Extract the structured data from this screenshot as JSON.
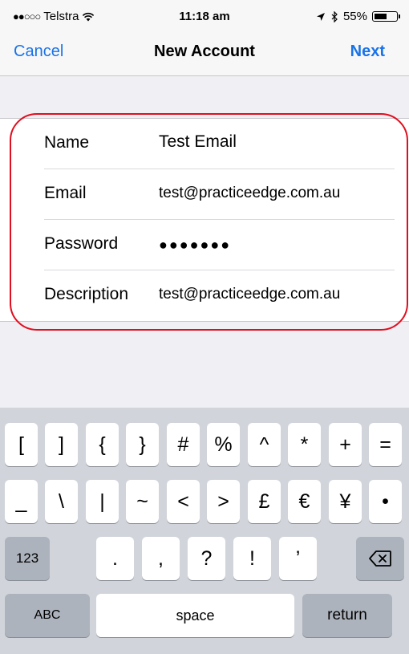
{
  "status": {
    "carrier": "Telstra",
    "time": "11:18 am",
    "battery": "55%",
    "signal_dots": "●●○○○"
  },
  "nav": {
    "cancel": "Cancel",
    "title": "New Account",
    "next": "Next"
  },
  "form": {
    "rows": [
      {
        "label": "Name",
        "value": "Test Email"
      },
      {
        "label": "Email",
        "value": "test@practiceedge.com.au"
      },
      {
        "label": "Password",
        "value": "●●●●●●●"
      },
      {
        "label": "Description",
        "value": "test@practiceedge.com.au"
      }
    ]
  },
  "keyboard": {
    "row1": [
      "[",
      "]",
      "{",
      "}",
      "#",
      "%",
      "^",
      "*",
      "+",
      "="
    ],
    "row2": [
      "_",
      "\\",
      "|",
      "~",
      "<",
      ">",
      "£",
      "€",
      "¥",
      "•"
    ],
    "row3": {
      "mode": "123",
      "keys": [
        ".",
        ",",
        "?",
        "!",
        "’"
      ]
    },
    "row4": {
      "abc": "ABC",
      "space": "space",
      "return": "return"
    }
  }
}
